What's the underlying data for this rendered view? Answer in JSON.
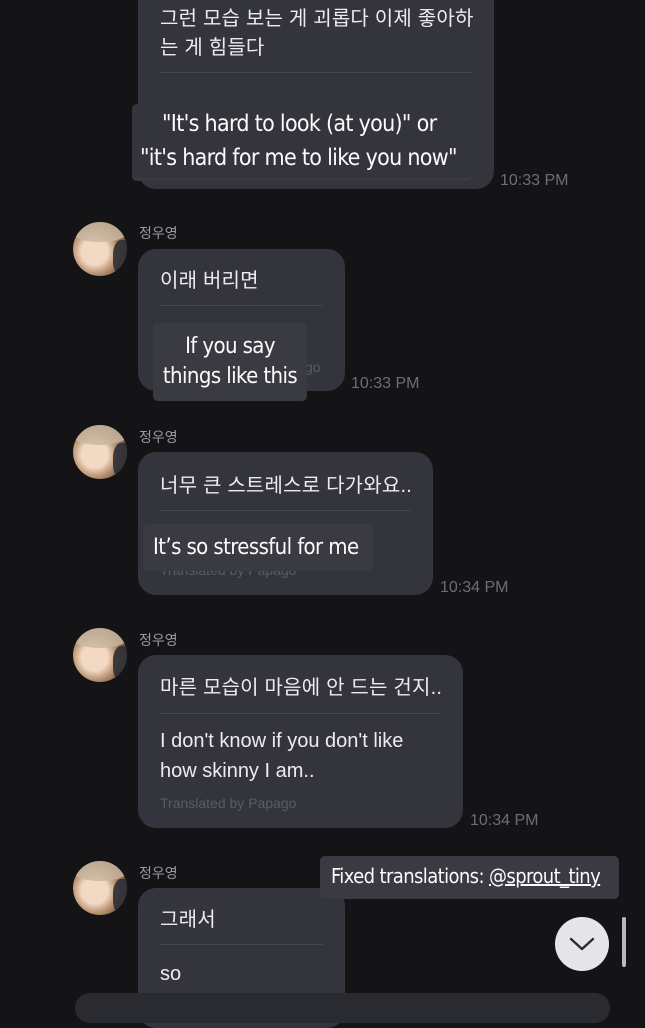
{
  "messages": [
    {
      "korean": [
        "그런 모습 보는 게 괴롭다 이제 좋아하",
        "는 게 힘들다"
      ],
      "time": "10:33 PM",
      "overlay": [
        "\"It's hard to look (at you)\" or",
        "\"it's hard for me to like you now\""
      ]
    },
    {
      "sender": "정우영",
      "korean": "이래 버리면",
      "partial_label": "go",
      "time": "10:33 PM",
      "overlay": [
        "If you say",
        "things like this"
      ]
    },
    {
      "sender": "정우영",
      "korean": "너무 큰 스트레스로 다가와요..",
      "translated_by": "Translated by Papago",
      "time": "10:34 PM",
      "overlay": [
        "It’s so stressful for me"
      ]
    },
    {
      "sender": "정우영",
      "korean": "마른 모습이 마음에 안 드는 건지..",
      "english": [
        "I don't know if you don't like",
        "how skinny I am.."
      ],
      "translated_by": "Translated by Papago",
      "time": "10:34 PM"
    },
    {
      "sender": "정우영",
      "korean": "그래서",
      "english": "so"
    }
  ],
  "credit": {
    "prefix": "Fixed translations: ",
    "handle": "@sprout_tiny"
  },
  "scroll_button_icon": "chevron-down-icon"
}
